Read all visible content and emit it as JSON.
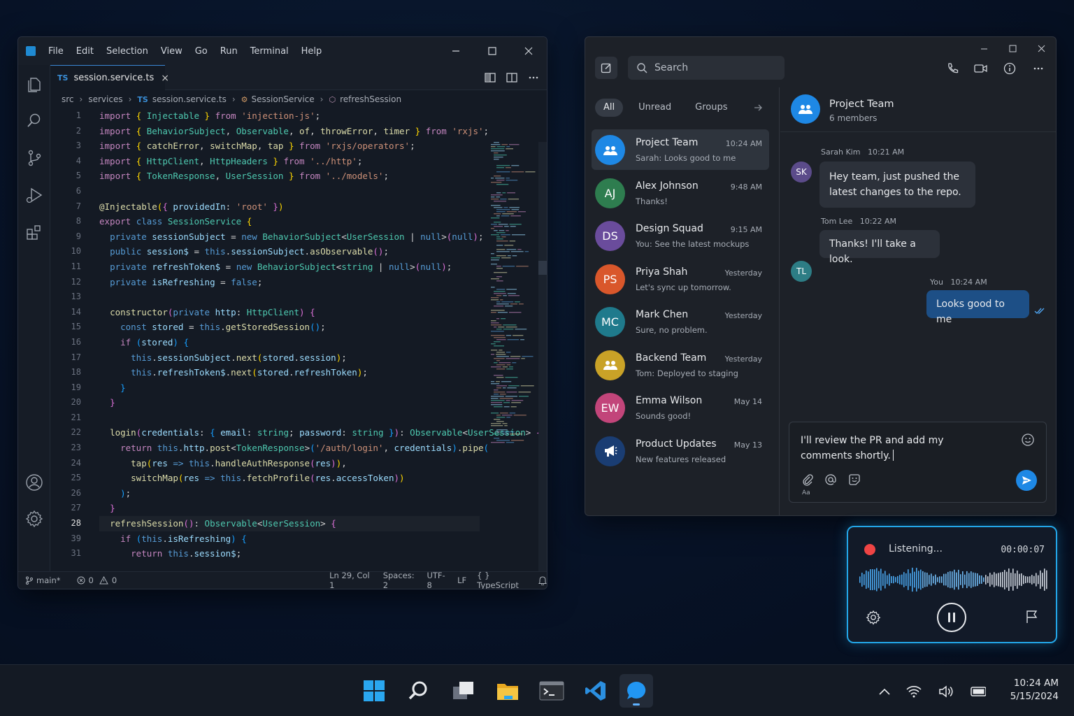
{
  "vscode": {
    "menu": [
      "File",
      "Edit",
      "Selection",
      "View",
      "Go",
      "Run",
      "Terminal",
      "Help"
    ],
    "tab": {
      "badge": "TS",
      "filename": "session.service.ts",
      "close": "×"
    },
    "breadcrumb": [
      "src",
      "services",
      "session.service.ts",
      "SessionService",
      "refreshSession"
    ],
    "line_numbers": [
      "1",
      "2",
      "3",
      "4",
      "5",
      "6",
      "7",
      "8",
      "9",
      "10",
      "11",
      "12",
      "13",
      "14",
      "15",
      "16",
      "17",
      "18",
      "19",
      "20",
      "21",
      "22",
      "23",
      "24",
      "25",
      "26",
      "27",
      "28",
      "39",
      "31"
    ],
    "status": {
      "branch": "main*",
      "errors": "0",
      "warnings": "0",
      "position": "Ln 29, Col 1",
      "spaces": "Spaces: 2",
      "encoding": "UTF-8",
      "eol": "LF",
      "language": "{ } TypeScript"
    },
    "code": [
      [
        [
          "kw",
          "import "
        ],
        [
          "br",
          "{ "
        ],
        [
          "ty",
          "Injectable"
        ],
        [
          "br",
          " }"
        ],
        [
          "kw",
          " from "
        ],
        [
          "str",
          "'injection-js'"
        ],
        [
          "pu",
          ";"
        ]
      ],
      [
        [
          "kw",
          "import "
        ],
        [
          "br",
          "{ "
        ],
        [
          "ty",
          "BehaviorSubject"
        ],
        [
          "pu",
          ", "
        ],
        [
          "ty",
          "Observable"
        ],
        [
          "pu",
          ", "
        ],
        [
          "fn",
          "of"
        ],
        [
          "pu",
          ", "
        ],
        [
          "fn",
          "throwError"
        ],
        [
          "pu",
          ", "
        ],
        [
          "fn",
          "timer"
        ],
        [
          "br",
          " }"
        ],
        [
          "kw",
          " from "
        ],
        [
          "str",
          "'rxjs'"
        ],
        [
          "pu",
          ";"
        ]
      ],
      [
        [
          "kw",
          "import "
        ],
        [
          "br",
          "{ "
        ],
        [
          "fn",
          "catchError"
        ],
        [
          "pu",
          ", "
        ],
        [
          "fn",
          "switchMap"
        ],
        [
          "pu",
          ", "
        ],
        [
          "fn",
          "tap"
        ],
        [
          "br",
          " }"
        ],
        [
          "kw",
          " from "
        ],
        [
          "str",
          "'rxjs/operators'"
        ],
        [
          "pu",
          ";"
        ]
      ],
      [
        [
          "kw",
          "import "
        ],
        [
          "br",
          "{ "
        ],
        [
          "ty",
          "HttpClient"
        ],
        [
          "pu",
          ", "
        ],
        [
          "ty",
          "HttpHeaders"
        ],
        [
          "br",
          " }"
        ],
        [
          "kw",
          " from "
        ],
        [
          "str",
          "'../http'"
        ],
        [
          "pu",
          ";"
        ]
      ],
      [
        [
          "kw",
          "import "
        ],
        [
          "br",
          "{ "
        ],
        [
          "ty",
          "TokenResponse"
        ],
        [
          "pu",
          ", "
        ],
        [
          "ty",
          "UserSession"
        ],
        [
          "br",
          " }"
        ],
        [
          "kw",
          " from "
        ],
        [
          "str",
          "'../models'"
        ],
        [
          "pu",
          ";"
        ]
      ],
      [],
      [
        [
          "fn",
          "@Injectable"
        ],
        [
          "br",
          "("
        ],
        [
          "br2",
          "{ "
        ],
        [
          "va",
          "providedIn"
        ],
        [
          "pu",
          ": "
        ],
        [
          "str",
          "'root'"
        ],
        [
          "br2",
          " }"
        ],
        [
          "br",
          ")"
        ]
      ],
      [
        [
          "kw",
          "export "
        ],
        [
          "kw2",
          "class "
        ],
        [
          "ty",
          "SessionService "
        ],
        [
          "br",
          "{"
        ]
      ],
      [
        [
          "pu",
          "  "
        ],
        [
          "kw2",
          "private "
        ],
        [
          "va",
          "sessionSubject"
        ],
        [
          "pu",
          " = "
        ],
        [
          "kw2",
          "new "
        ],
        [
          "ty",
          "BehaviorSubject"
        ],
        [
          "pu",
          "<"
        ],
        [
          "ty",
          "UserSession"
        ],
        [
          "pu",
          " | "
        ],
        [
          "kw2",
          "null"
        ],
        [
          "pu",
          ">"
        ],
        [
          "br2",
          "("
        ],
        [
          "kw2",
          "null"
        ],
        [
          "br2",
          ")"
        ],
        [
          "pu",
          ";"
        ]
      ],
      [
        [
          "pu",
          "  "
        ],
        [
          "kw2",
          "public "
        ],
        [
          "va",
          "session$"
        ],
        [
          "pu",
          " = "
        ],
        [
          "th",
          "this"
        ],
        [
          "pu",
          "."
        ],
        [
          "va",
          "sessionSubject"
        ],
        [
          "pu",
          "."
        ],
        [
          "fn",
          "asObservable"
        ],
        [
          "br2",
          "()"
        ],
        [
          "pu",
          ";"
        ]
      ],
      [
        [
          "pu",
          "  "
        ],
        [
          "kw2",
          "private "
        ],
        [
          "va",
          "refreshToken$"
        ],
        [
          "pu",
          " = "
        ],
        [
          "kw2",
          "new "
        ],
        [
          "ty",
          "BehaviorSubject"
        ],
        [
          "pu",
          "<"
        ],
        [
          "ty",
          "string"
        ],
        [
          "pu",
          " | "
        ],
        [
          "kw2",
          "null"
        ],
        [
          "pu",
          ">"
        ],
        [
          "br2",
          "("
        ],
        [
          "kw2",
          "null"
        ],
        [
          "br2",
          ")"
        ],
        [
          "pu",
          ";"
        ]
      ],
      [
        [
          "pu",
          "  "
        ],
        [
          "kw2",
          "private "
        ],
        [
          "va",
          "isRefreshing"
        ],
        [
          "pu",
          " = "
        ],
        [
          "kw2",
          "false"
        ],
        [
          "pu",
          ";"
        ]
      ],
      [],
      [
        [
          "pu",
          "  "
        ],
        [
          "fn",
          "constructor"
        ],
        [
          "br2",
          "("
        ],
        [
          "kw2",
          "private "
        ],
        [
          "pm",
          "http"
        ],
        [
          "pu",
          ": "
        ],
        [
          "ty",
          "HttpClient"
        ],
        [
          "br2",
          ")"
        ],
        [
          "pu",
          " "
        ],
        [
          "br2",
          "{"
        ]
      ],
      [
        [
          "pu",
          "    "
        ],
        [
          "kw2",
          "const "
        ],
        [
          "va",
          "stored"
        ],
        [
          "pu",
          " = "
        ],
        [
          "th",
          "this"
        ],
        [
          "pu",
          "."
        ],
        [
          "fn",
          "getStoredSession"
        ],
        [
          "br3",
          "()"
        ],
        [
          "pu",
          ";"
        ]
      ],
      [
        [
          "pu",
          "    "
        ],
        [
          "kw",
          "if "
        ],
        [
          "br3",
          "("
        ],
        [
          "va",
          "stored"
        ],
        [
          "br3",
          ")"
        ],
        [
          "pu",
          " "
        ],
        [
          "br3",
          "{"
        ]
      ],
      [
        [
          "pu",
          "      "
        ],
        [
          "th",
          "this"
        ],
        [
          "pu",
          "."
        ],
        [
          "va",
          "sessionSubject"
        ],
        [
          "pu",
          "."
        ],
        [
          "fn",
          "next"
        ],
        [
          "br",
          "("
        ],
        [
          "va",
          "stored"
        ],
        [
          "pu",
          "."
        ],
        [
          "va",
          "session"
        ],
        [
          "br",
          ")"
        ],
        [
          "pu",
          ";"
        ]
      ],
      [
        [
          "pu",
          "      "
        ],
        [
          "th",
          "this"
        ],
        [
          "pu",
          "."
        ],
        [
          "va",
          "refreshToken$"
        ],
        [
          "pu",
          "."
        ],
        [
          "fn",
          "next"
        ],
        [
          "br",
          "("
        ],
        [
          "va",
          "stored"
        ],
        [
          "pu",
          "."
        ],
        [
          "va",
          "refreshToken"
        ],
        [
          "br",
          ")"
        ],
        [
          "pu",
          ";"
        ]
      ],
      [
        [
          "pu",
          "    "
        ],
        [
          "br3",
          "}"
        ]
      ],
      [
        [
          "pu",
          "  "
        ],
        [
          "br2",
          "}"
        ]
      ],
      [],
      [
        [
          "pu",
          "  "
        ],
        [
          "fn",
          "login"
        ],
        [
          "br2",
          "("
        ],
        [
          "pm",
          "credentials"
        ],
        [
          "pu",
          ": "
        ],
        [
          "br3",
          "{ "
        ],
        [
          "va",
          "email"
        ],
        [
          "pu",
          ": "
        ],
        [
          "ty",
          "string"
        ],
        [
          "pu",
          "; "
        ],
        [
          "va",
          "password"
        ],
        [
          "pu",
          ": "
        ],
        [
          "ty",
          "string"
        ],
        [
          "br3",
          " }"
        ],
        [
          "br2",
          ")"
        ],
        [
          "pu",
          ": "
        ],
        [
          "ty",
          "Observable"
        ],
        [
          "pu",
          "<"
        ],
        [
          "ty",
          "UserSession"
        ],
        [
          "pu",
          "> "
        ],
        [
          "br2",
          "{"
        ]
      ],
      [
        [
          "pu",
          "    "
        ],
        [
          "kw",
          "return "
        ],
        [
          "th",
          "this"
        ],
        [
          "pu",
          "."
        ],
        [
          "va",
          "http"
        ],
        [
          "pu",
          "."
        ],
        [
          "fn",
          "post"
        ],
        [
          "pu",
          "<"
        ],
        [
          "ty",
          "TokenResponse"
        ],
        [
          "pu",
          ">"
        ],
        [
          "br3",
          "("
        ],
        [
          "str",
          "'/auth/login'"
        ],
        [
          "pu",
          ", "
        ],
        [
          "va",
          "credentials"
        ],
        [
          "br3",
          ")"
        ],
        [
          "pu",
          "."
        ],
        [
          "fn",
          "pipe"
        ],
        [
          "br3",
          "("
        ]
      ],
      [
        [
          "pu",
          "      "
        ],
        [
          "fn",
          "tap"
        ],
        [
          "br",
          "("
        ],
        [
          "pm",
          "res"
        ],
        [
          "kw2",
          " => "
        ],
        [
          "th",
          "this"
        ],
        [
          "pu",
          "."
        ],
        [
          "fn",
          "handleAuthResponse"
        ],
        [
          "br2",
          "("
        ],
        [
          "va",
          "res"
        ],
        [
          "br2",
          ")"
        ],
        [
          "br",
          ")"
        ],
        [
          "pu",
          ","
        ]
      ],
      [
        [
          "pu",
          "      "
        ],
        [
          "fn",
          "switchMap"
        ],
        [
          "br",
          "("
        ],
        [
          "pm",
          "res"
        ],
        [
          "kw2",
          " => "
        ],
        [
          "th",
          "this"
        ],
        [
          "pu",
          "."
        ],
        [
          "fn",
          "fetchProfile"
        ],
        [
          "br2",
          "("
        ],
        [
          "va",
          "res"
        ],
        [
          "pu",
          "."
        ],
        [
          "va",
          "accessToken"
        ],
        [
          "br2",
          ")"
        ],
        [
          "br",
          ")"
        ]
      ],
      [
        [
          "pu",
          "    "
        ],
        [
          "br3",
          ")"
        ],
        [
          "pu",
          ";"
        ]
      ],
      [
        [
          "pu",
          "  "
        ],
        [
          "br2",
          "}"
        ]
      ],
      [
        [
          "pu",
          "  "
        ],
        [
          "fn",
          "refreshSession"
        ],
        [
          "br2",
          "()"
        ],
        [
          "pu",
          ": "
        ],
        [
          "ty",
          "Observable"
        ],
        [
          "pu",
          "<"
        ],
        [
          "ty",
          "UserSession"
        ],
        [
          "pu",
          "> "
        ],
        [
          "br2",
          "{"
        ]
      ],
      [
        [
          "pu",
          "    "
        ],
        [
          "kw",
          "if "
        ],
        [
          "br3",
          "("
        ],
        [
          "th",
          "this"
        ],
        [
          "pu",
          "."
        ],
        [
          "va",
          "isRefreshing"
        ],
        [
          "br3",
          ")"
        ],
        [
          "pu",
          " "
        ],
        [
          "br3",
          "{"
        ]
      ],
      [
        [
          "pu",
          "      "
        ],
        [
          "kw",
          "return "
        ],
        [
          "th",
          "this"
        ],
        [
          "pu",
          "."
        ],
        [
          "va",
          "session$"
        ],
        [
          "pu",
          ";"
        ]
      ]
    ]
  },
  "chat": {
    "search_placeholder": "Search",
    "filters": [
      "All",
      "Unread",
      "Groups"
    ],
    "conversations": [
      {
        "name": "Project Team",
        "preview": "Sarah: Looks good to me",
        "time": "10:24 AM",
        "initials": "",
        "color": "#1e88e5",
        "icon": "group-icon"
      },
      {
        "name": "Alex Johnson",
        "preview": "Thanks!",
        "time": "9:48 AM",
        "initials": "AJ",
        "color": "#2e7d4f"
      },
      {
        "name": "Design Squad",
        "preview": "You: See the latest mockups",
        "time": "9:15 AM",
        "initials": "DS",
        "color": "#6a4c9c"
      },
      {
        "name": "Priya Shah",
        "preview": "Let's sync up tomorrow.",
        "time": "Yesterday",
        "initials": "PS",
        "color": "#d9572b"
      },
      {
        "name": "Mark Chen",
        "preview": "Sure, no problem.",
        "time": "Yesterday",
        "initials": "MC",
        "color": "#1f7a8c"
      },
      {
        "name": "Backend Team",
        "preview": "Tom: Deployed to staging",
        "time": "Yesterday",
        "initials": "",
        "color": "#c9a227",
        "icon": "group-icon"
      },
      {
        "name": "Emma Wilson",
        "preview": "Sounds good!",
        "time": "May 14",
        "initials": "EW",
        "color": "#c2457a"
      },
      {
        "name": "Product Updates",
        "preview": "New features released",
        "time": "May 13",
        "initials": "",
        "color": "#1a3d73",
        "icon": "megaphone-icon"
      }
    ],
    "thread": {
      "title": "Project Team",
      "subtitle": "6 members",
      "messages": [
        {
          "author": "Sarah Kim",
          "time": "10:21 AM",
          "initials": "SK",
          "color": "#5b4b8a",
          "text": [
            "Hey team, just pushed the",
            "latest changes to the repo."
          ]
        },
        {
          "author": "Tom Lee",
          "time": "10:22 AM",
          "initials": "TL",
          "color": "#2d7d85",
          "text": [
            "Thanks! I'll take a look."
          ]
        },
        {
          "author": "You",
          "time": "10:24 AM",
          "text": [
            "Looks good to me"
          ]
        }
      ]
    },
    "composer": {
      "text": "I'll review the PR and add my comments shortly.",
      "format_label": "Aa"
    }
  },
  "voice": {
    "status": "Listening...",
    "timer": "00:00:07",
    "accent": "#23a6e8"
  },
  "taskbar": {
    "time": "10:24 AM",
    "date": "5/15/2024"
  }
}
